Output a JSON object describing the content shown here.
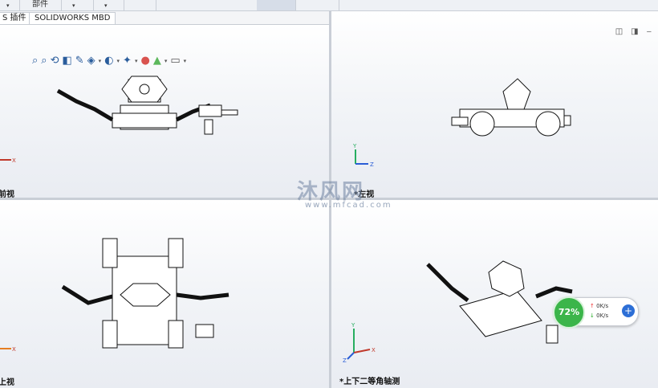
{
  "topbar": {
    "part_label": "部件"
  },
  "tabs": [
    "S 插件",
    "SOLIDWORKS MBD"
  ],
  "views": {
    "top_left": "前视",
    "top_right": "*左视",
    "bottom_left": "上视",
    "bottom_right": "*上下二等角轴测"
  },
  "watermark": {
    "brand": "沐风网",
    "url": "www.mfcad.com"
  },
  "network": {
    "percent": "72%",
    "upload": "0K/s",
    "download": "0K/s"
  },
  "colors": {
    "pane_bg": "#eef0f5",
    "accent_green": "#3bb54a",
    "accent_blue": "#2d6fd6"
  }
}
